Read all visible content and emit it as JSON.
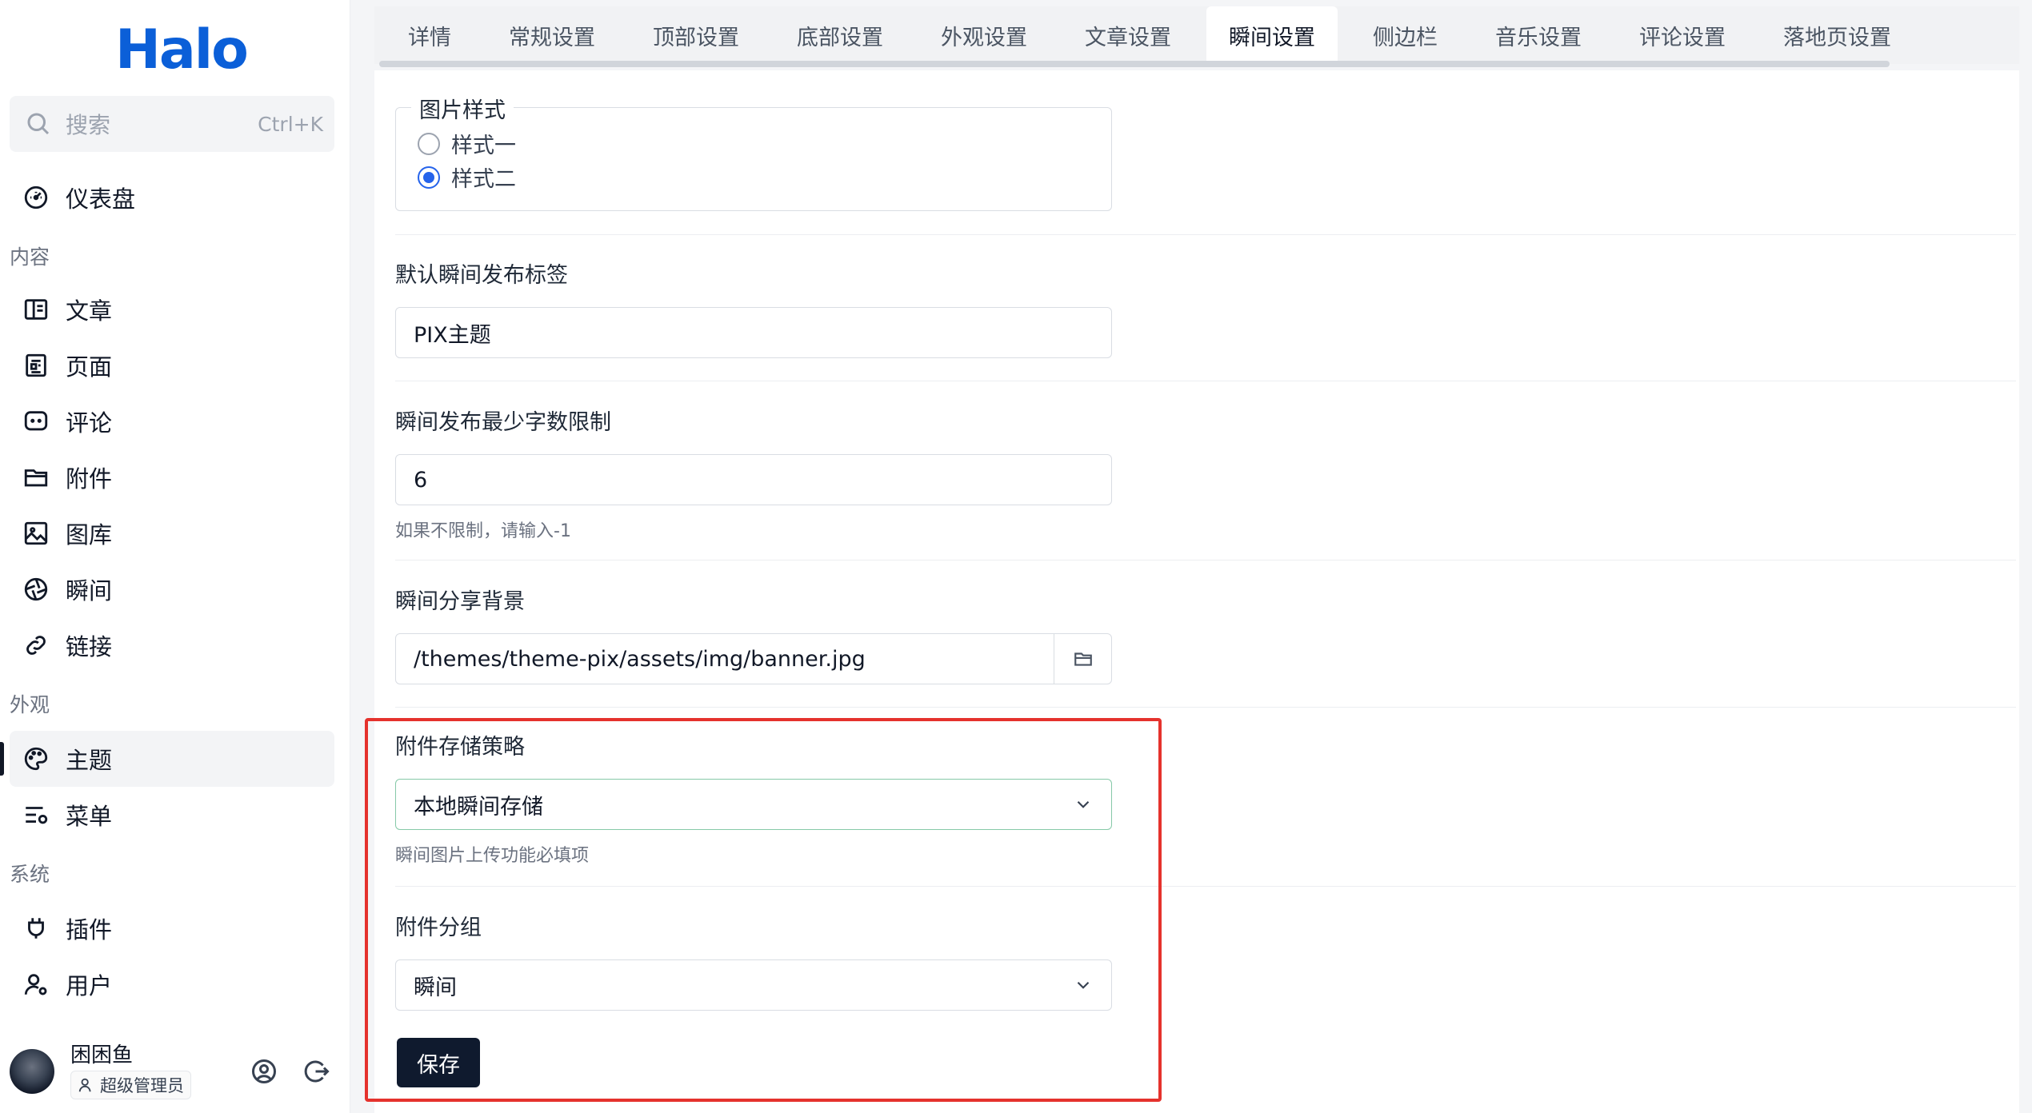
{
  "app": {
    "logo_text": "Halo",
    "brand_color": "#0b5fd8"
  },
  "search": {
    "placeholder": "搜索",
    "shortcut": "Ctrl+K"
  },
  "sidebar": {
    "dashboard": "仪表盘",
    "sections": {
      "content": "内容",
      "appearance": "外观",
      "system": "系统"
    },
    "content_items": [
      "文章",
      "页面",
      "评论",
      "附件",
      "图库",
      "瞬间",
      "链接"
    ],
    "appearance_items": [
      "主题",
      "菜单"
    ],
    "system_items": [
      "插件",
      "用户"
    ],
    "active_item": "主题"
  },
  "user": {
    "name": "困困鱼",
    "role": "超级管理员"
  },
  "tabs": [
    "详情",
    "常规设置",
    "顶部设置",
    "底部设置",
    "外观设置",
    "文章设置",
    "瞬间设置",
    "侧边栏",
    "音乐设置",
    "评论设置",
    "落地页设置"
  ],
  "active_tab": "瞬间设置",
  "form": {
    "image_style": {
      "legend": "图片样式",
      "options": [
        "样式一",
        "样式二"
      ],
      "selected": "样式二"
    },
    "default_tag": {
      "label": "默认瞬间发布标签",
      "value": "PIX主题"
    },
    "min_chars": {
      "label": "瞬间发布最少字数限制",
      "value": "6",
      "help": "如果不限制，请输入-1"
    },
    "share_bg": {
      "label": "瞬间分享背景",
      "value": "/themes/theme-pix/assets/img/banner.jpg"
    },
    "storage_policy": {
      "label": "附件存储策略",
      "value": "本地瞬间存储",
      "help": "瞬间图片上传功能必填项"
    },
    "attachment_group": {
      "label": "附件分组",
      "value": "瞬间"
    },
    "save_label": "保存"
  },
  "highlight_color": "#e5322d"
}
